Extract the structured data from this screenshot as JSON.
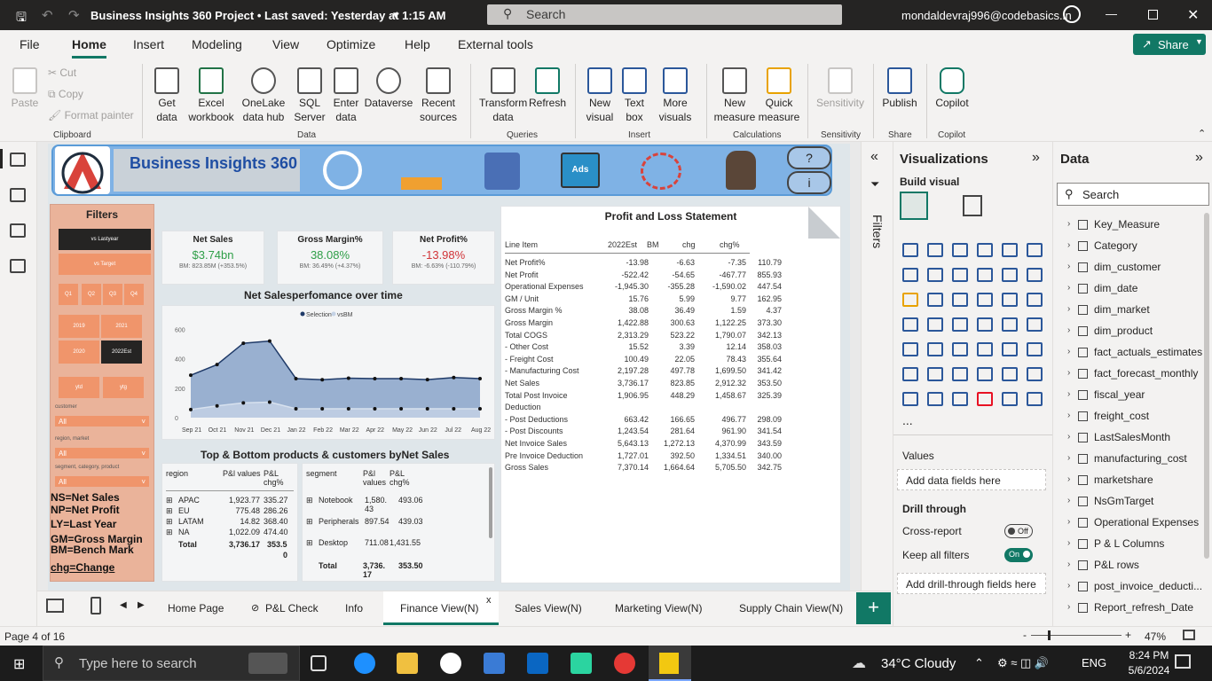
{
  "titlebar": {
    "title": "Business Insights 360 Project • Last saved: Yesterday at 1:15 AM",
    "search_placeholder": "Search",
    "user": "mondaldevraj996@codebasics.in"
  },
  "menu": {
    "items": [
      "File",
      "Home",
      "Insert",
      "Modeling",
      "View",
      "Optimize",
      "Help",
      "External tools"
    ],
    "share": "Share"
  },
  "ribbon": {
    "buttons": [
      {
        "label": "Paste",
        "group": "Clipboard"
      },
      {
        "label": "Cut"
      },
      {
        "label": "Copy"
      },
      {
        "label": "Format painter"
      },
      {
        "label": "Get data",
        "group": "Data"
      },
      {
        "label": "Excel workbook"
      },
      {
        "label": "OneLake data hub"
      },
      {
        "label": "SQL Server"
      },
      {
        "label": "Enter data"
      },
      {
        "label": "Dataverse"
      },
      {
        "label": "Recent sources"
      },
      {
        "label": "Transform data",
        "group": "Queries"
      },
      {
        "label": "Refresh"
      },
      {
        "label": "New visual",
        "group": "Insert"
      },
      {
        "label": "Text box"
      },
      {
        "label": "More visuals"
      },
      {
        "label": "New measure",
        "group": "Calculations"
      },
      {
        "label": "Quick measure"
      },
      {
        "label": "Sensitivity",
        "group": "Sensitivity"
      },
      {
        "label": "Publish",
        "group": "Share"
      },
      {
        "label": "Copilot",
        "group": "Copilot"
      }
    ],
    "groups": [
      "Clipboard",
      "Data",
      "Queries",
      "Insert",
      "Calculations",
      "Sensitivity",
      "Share",
      "Copilot"
    ]
  },
  "report": {
    "title": "Business Insights 360",
    "filters": {
      "title": "Filters",
      "vs_ly": "vs Lastyear",
      "vs_target": "vs Target",
      "quarters": [
        "Q1",
        "Q2",
        "Q3",
        "Q4"
      ],
      "years": [
        "2019",
        "2021",
        "2020",
        "2022Est"
      ],
      "ytd": "ytd",
      "ytg": "ytg",
      "customer_label": "customer",
      "customer_value": "All",
      "region_label": "region, market",
      "region_value": "All",
      "segment_label": "segment, category, product",
      "segment_value": "All"
    },
    "legend_lines": [
      "NS=Net Sales",
      "NP=Net Profit",
      "LY=Last Year",
      "GM=Gross Margin",
      "BM=Bench Mark",
      "chg=Change"
    ],
    "cards": [
      {
        "title": "Net Sales",
        "value": "$3.74bn",
        "sub": "BM: 823.85M (+353.5%)",
        "color": "#2e9e47"
      },
      {
        "title": "Gross Margin%",
        "value": "38.08%",
        "sub": "BM: 36.49% (+4.37%)",
        "color": "#2e9e47"
      },
      {
        "title": "Net Profit%",
        "value": "-13.98%",
        "sub": "BM: -6.63% (-110.79%)",
        "color": "#d13438"
      }
    ],
    "chart_title": "Net Salesperfomance over time",
    "chart_data": {
      "type": "area",
      "categories": [
        "Sep 21",
        "Oct 21",
        "Nov 21",
        "Dec 21",
        "Jan 22",
        "Feb 22",
        "Mar 22",
        "Apr 22",
        "May 22",
        "Jun 22",
        "Jul 22",
        "Aug 22"
      ],
      "series": [
        {
          "name": "Selection",
          "values": [
            288,
            360,
            505,
            520,
            265,
            257,
            268,
            265,
            265,
            258,
            272,
            265
          ]
        },
        {
          "name": "vsBM",
          "values": [
            55,
            80,
            100,
            105,
            60,
            60,
            60,
            60,
            60,
            60,
            60,
            60
          ]
        }
      ],
      "ylim": [
        0,
        650
      ],
      "yticks": [
        "0",
        "200",
        "400",
        "600"
      ],
      "legend": "top-center"
    },
    "topbottom_title": "Top & Bottom products & customers byNet Sales",
    "region_table": {
      "headers": [
        "region",
        "P&l values",
        "P&L chg%"
      ],
      "rows": [
        [
          "APAC",
          "1,923.77",
          "335.27"
        ],
        [
          "EU",
          "775.48",
          "286.26"
        ],
        [
          "LATAM",
          "14.82",
          "368.40"
        ],
        [
          "NA",
          "1,022.09",
          "474.40"
        ]
      ],
      "total": [
        "Total",
        "3,736.17",
        "353.5",
        "0"
      ]
    },
    "segment_table": {
      "headers": [
        "segment",
        "P&l values",
        "P&L chg%"
      ],
      "rows": [
        [
          "Notebook",
          "1,580.43",
          "493.06"
        ],
        [
          "Peripherals",
          "897.54",
          "439.03"
        ],
        [
          "Desktop",
          "711.08",
          "1,431.55"
        ]
      ],
      "total": [
        "Total",
        "3,736.17",
        "353.50"
      ]
    },
    "pl": {
      "title": "Profit and Loss Statement",
      "headers": [
        "Line Item",
        "2022Est",
        "BM",
        "chg",
        "chg%"
      ],
      "rows": [
        [
          "Net Profit%",
          "-13.98",
          "-6.63",
          "-7.35",
          "110.79"
        ],
        [
          "Net Profit",
          "-522.42",
          "-54.65",
          "-467.77",
          "855.93"
        ],
        [
          "Operational Expenses",
          "-1,945.30",
          "-355.28",
          "-1,590.02",
          "447.54"
        ],
        [
          "GM / Unit",
          "15.76",
          "5.99",
          "9.77",
          "162.95"
        ],
        [
          "Gross Margin %",
          "38.08",
          "36.49",
          "1.59",
          "4.37"
        ],
        [
          "Gross Margin",
          "1,422.88",
          "300.63",
          "1,122.25",
          "373.30"
        ],
        [
          "Total COGS",
          "2,313.29",
          "523.22",
          "1,790.07",
          "342.13"
        ],
        [
          "- Other Cost",
          "15.52",
          "3.39",
          "12.14",
          "358.03"
        ],
        [
          "- Freight Cost",
          "100.49",
          "22.05",
          "78.43",
          "355.64"
        ],
        [
          "- Manufacturing Cost",
          "2,197.28",
          "497.78",
          "1,699.50",
          "341.42"
        ],
        [
          "Net Sales",
          "3,736.17",
          "823.85",
          "2,912.32",
          "353.50"
        ],
        [
          "Total Post Invoice",
          "1,906.95",
          "448.29",
          "1,458.67",
          "325.39"
        ],
        [
          "Deduction",
          "",
          "",
          "",
          ""
        ],
        [
          "- Post Deductions",
          "663.42",
          "166.65",
          "496.77",
          "298.09"
        ],
        [
          "- Post Discounts",
          "1,243.54",
          "281.64",
          "961.90",
          "341.54"
        ],
        [
          "Net Invoice Sales",
          "5,643.13",
          "1,272.13",
          "4,370.99",
          "343.59"
        ],
        [
          "Pre Invoice Deduction",
          "1,727.01",
          "392.50",
          "1,334.51",
          "340.00"
        ],
        [
          "Gross Sales",
          "7,370.14",
          "1,664.64",
          "5,705.50",
          "342.75"
        ]
      ]
    }
  },
  "filters_pane": {
    "label": "Filters"
  },
  "vis_pane": {
    "title": "Visualizations",
    "build_visual": "Build visual",
    "values": "Values",
    "add_data_fields": "Add data fields here",
    "drill_through": "Drill through",
    "cross_report": "Cross-report",
    "cross_report_state": "Off",
    "keep_all_filters": "Keep all filters",
    "keep_all_state": "On",
    "add_drill_fields": "Add drill-through fields here",
    "more": "..."
  },
  "data_pane": {
    "title": "Data",
    "search_placeholder": "Search",
    "fields": [
      "Key_Measure",
      "Category",
      "dim_customer",
      "dim_date",
      "dim_market",
      "dim_product",
      "fact_actuals_estimates",
      "fact_forecast_monthly",
      "fiscal_year",
      "freight_cost",
      "LastSalesMonth",
      "manufacturing_cost",
      "marketshare",
      "NsGmTarget",
      "Operational Expenses",
      "P & L Columns",
      "P&L rows",
      "post_invoice_deducti...",
      "Report_refresh_Date"
    ]
  },
  "tabs": {
    "items": [
      "Home Page",
      "P&L Check",
      "Info",
      "Finance View(N)",
      "Sales View(N)",
      "Marketing View(N)",
      "Supply Chain View(N)"
    ],
    "active": "Finance View(N)",
    "close": "x",
    "add": "+"
  },
  "statusbar": {
    "page": "Page 4 of 16",
    "zoom": "47%"
  },
  "taskbar": {
    "search_placeholder": "Type here to search",
    "weather": "34°C  Cloudy",
    "lang": "ENG",
    "time": "8:24 PM",
    "date": "5/6/2024"
  }
}
